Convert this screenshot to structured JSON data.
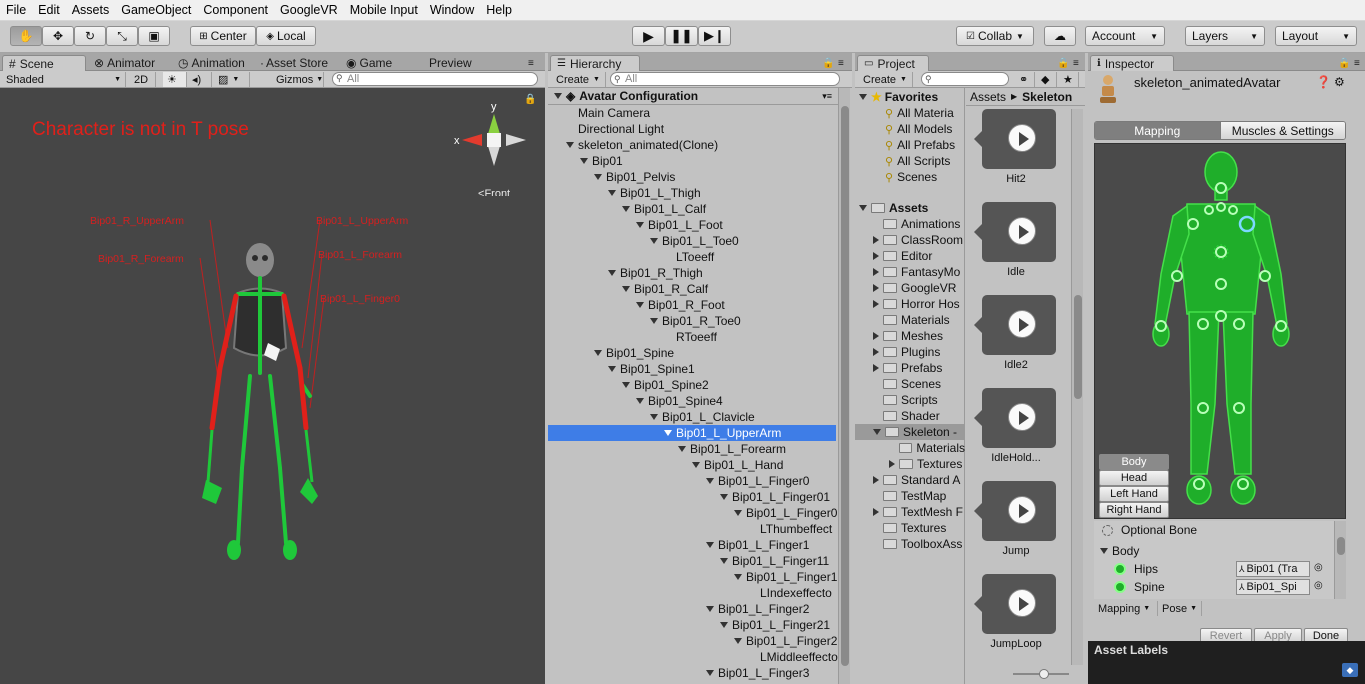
{
  "menu": [
    "File",
    "Edit",
    "Assets",
    "GameObject",
    "Component",
    "GoogleVR",
    "Mobile Input",
    "Window",
    "Help"
  ],
  "toolbar": {
    "pivot": "Center",
    "space": "Local",
    "collab": "Collab",
    "account": "Account",
    "layers": "Layers",
    "layout": "Layout"
  },
  "scene": {
    "tabs": [
      "Scene",
      "Animator",
      "Animation",
      "Asset Store",
      "Game",
      "Preview"
    ],
    "shading": "Shaded",
    "mode2d": "2D",
    "gizmos": "Gizmos",
    "search_placeholder": "All",
    "warning": "Character is not in T pose",
    "gizmo_y": "y",
    "gizmo_x": "x",
    "view_label": "Front",
    "bone_labels": {
      "r_upperarm": "Bip01_R_UpperArm",
      "r_forearm": "Bip01_R_Forearm",
      "l_upperarm": "Bip01_L_UpperArm",
      "l_forearm": "Bip01_L_Forearm",
      "l_finger": "Bip01_L_Finger0"
    },
    "colors": {
      "bg": "#464646",
      "bone_ok": "#22c55e",
      "bone_bad": "#e0201a",
      "warning": "#e0201a"
    }
  },
  "hierarchy": {
    "tab": "Hierarchy",
    "create": "Create",
    "search_placeholder": "All",
    "root": "Avatar Configuration",
    "rows": [
      {
        "label": "Main Camera",
        "indent": 0,
        "arrow": false
      },
      {
        "label": "Directional Light",
        "indent": 0,
        "arrow": false
      },
      {
        "label": "skeleton_animated(Clone)",
        "indent": 0,
        "arrow": true
      },
      {
        "label": "Bip01",
        "indent": 1,
        "arrow": true
      },
      {
        "label": "Bip01_Pelvis",
        "indent": 2,
        "arrow": true
      },
      {
        "label": "Bip01_L_Thigh",
        "indent": 3,
        "arrow": true
      },
      {
        "label": "Bip01_L_Calf",
        "indent": 4,
        "arrow": true
      },
      {
        "label": "Bip01_L_Foot",
        "indent": 5,
        "arrow": true
      },
      {
        "label": "Bip01_L_Toe0",
        "indent": 6,
        "arrow": true
      },
      {
        "label": "LToeeff",
        "indent": 7,
        "arrow": false
      },
      {
        "label": "Bip01_R_Thigh",
        "indent": 3,
        "arrow": true
      },
      {
        "label": "Bip01_R_Calf",
        "indent": 4,
        "arrow": true
      },
      {
        "label": "Bip01_R_Foot",
        "indent": 5,
        "arrow": true
      },
      {
        "label": "Bip01_R_Toe0",
        "indent": 6,
        "arrow": true
      },
      {
        "label": "RToeeff",
        "indent": 7,
        "arrow": false
      },
      {
        "label": "Bip01_Spine",
        "indent": 2,
        "arrow": true
      },
      {
        "label": "Bip01_Spine1",
        "indent": 3,
        "arrow": true
      },
      {
        "label": "Bip01_Spine2",
        "indent": 4,
        "arrow": true
      },
      {
        "label": "Bip01_Spine4",
        "indent": 5,
        "arrow": true
      },
      {
        "label": "Bip01_L_Clavicle",
        "indent": 6,
        "arrow": true
      },
      {
        "label": "Bip01_L_UpperArm",
        "indent": 7,
        "arrow": true,
        "selected": true
      },
      {
        "label": "Bip01_L_Forearm",
        "indent": 8,
        "arrow": true
      },
      {
        "label": "Bip01_L_Hand",
        "indent": 9,
        "arrow": true
      },
      {
        "label": "Bip01_L_Finger0",
        "indent": 10,
        "arrow": true
      },
      {
        "label": "Bip01_L_Finger01",
        "indent": 11,
        "arrow": true
      },
      {
        "label": "Bip01_L_Finger0",
        "indent": 12,
        "arrow": true
      },
      {
        "label": "LThumbeffect",
        "indent": 13,
        "arrow": false
      },
      {
        "label": "Bip01_L_Finger1",
        "indent": 10,
        "arrow": true
      },
      {
        "label": "Bip01_L_Finger11",
        "indent": 11,
        "arrow": true
      },
      {
        "label": "Bip01_L_Finger1",
        "indent": 12,
        "arrow": true
      },
      {
        "label": "LIndexeffecto",
        "indent": 13,
        "arrow": false
      },
      {
        "label": "Bip01_L_Finger2",
        "indent": 10,
        "arrow": true
      },
      {
        "label": "Bip01_L_Finger21",
        "indent": 11,
        "arrow": true
      },
      {
        "label": "Bip01_L_Finger2",
        "indent": 12,
        "arrow": true
      },
      {
        "label": "LMiddleeffecto",
        "indent": 13,
        "arrow": false
      },
      {
        "label": "Bip01_L_Finger3",
        "indent": 10,
        "arrow": true
      }
    ]
  },
  "project": {
    "tab": "Project",
    "create": "Create",
    "favorites": "Favorites",
    "fav_items": [
      "All Materia",
      "All Models",
      "All Prefabs",
      "All Scripts",
      "Scenes"
    ],
    "assets_root": "Assets",
    "folders": [
      {
        "label": "Animations",
        "arrow": false,
        "indent": 1
      },
      {
        "label": "ClassRoom",
        "arrow": true,
        "indent": 1
      },
      {
        "label": "Editor",
        "arrow": true,
        "indent": 1
      },
      {
        "label": "FantasyMo",
        "arrow": true,
        "indent": 1
      },
      {
        "label": "GoogleVR",
        "arrow": true,
        "indent": 1
      },
      {
        "label": "Horror Hos",
        "arrow": true,
        "indent": 1
      },
      {
        "label": "Materials",
        "arrow": false,
        "indent": 1
      },
      {
        "label": "Meshes",
        "arrow": true,
        "indent": 1
      },
      {
        "label": "Plugins",
        "arrow": true,
        "indent": 1
      },
      {
        "label": "Prefabs",
        "arrow": true,
        "indent": 1
      },
      {
        "label": "Scenes",
        "arrow": false,
        "indent": 1
      },
      {
        "label": "Scripts",
        "arrow": false,
        "indent": 1
      },
      {
        "label": "Shader",
        "arrow": false,
        "indent": 1
      },
      {
        "label": "Skeleton -",
        "arrow": "open",
        "indent": 1,
        "selected": true
      },
      {
        "label": "Materials",
        "arrow": false,
        "indent": 2
      },
      {
        "label": "Textures",
        "arrow": true,
        "indent": 2
      },
      {
        "label": "Standard A",
        "arrow": true,
        "indent": 1
      },
      {
        "label": "TestMap",
        "arrow": false,
        "indent": 1
      },
      {
        "label": "TextMesh F",
        "arrow": true,
        "indent": 1
      },
      {
        "label": "Textures",
        "arrow": false,
        "indent": 1
      },
      {
        "label": "ToolboxAss",
        "arrow": false,
        "indent": 1
      }
    ],
    "breadcrumb": [
      "Assets",
      "Skeleton"
    ],
    "assets": [
      "Hit2",
      "Idle",
      "Idle2",
      "IdleHold...",
      "Jump",
      "JumpLoop"
    ]
  },
  "inspector": {
    "tab": "Inspector",
    "object_name": "skeleton_animatedAvatar",
    "tabs": [
      "Mapping",
      "Muscles & Settings"
    ],
    "body_parts": [
      "Body",
      "Head",
      "Left Hand",
      "Right Hand"
    ],
    "optional_bone": "Optional Bone",
    "section": "Body",
    "bones": [
      {
        "label": "Hips",
        "value": "Bip01 (Tra"
      },
      {
        "label": "Spine",
        "value": "Bip01_Spi"
      }
    ],
    "mapping_menu": "Mapping",
    "pose_menu": "Pose",
    "buttons": {
      "revert": "Revert",
      "apply": "Apply",
      "done": "Done"
    },
    "asset_labels": "Asset Labels",
    "colors": {
      "figure": "#1fae2a",
      "figure_stroke": "#45e04a",
      "joint": "#22d62e"
    }
  }
}
